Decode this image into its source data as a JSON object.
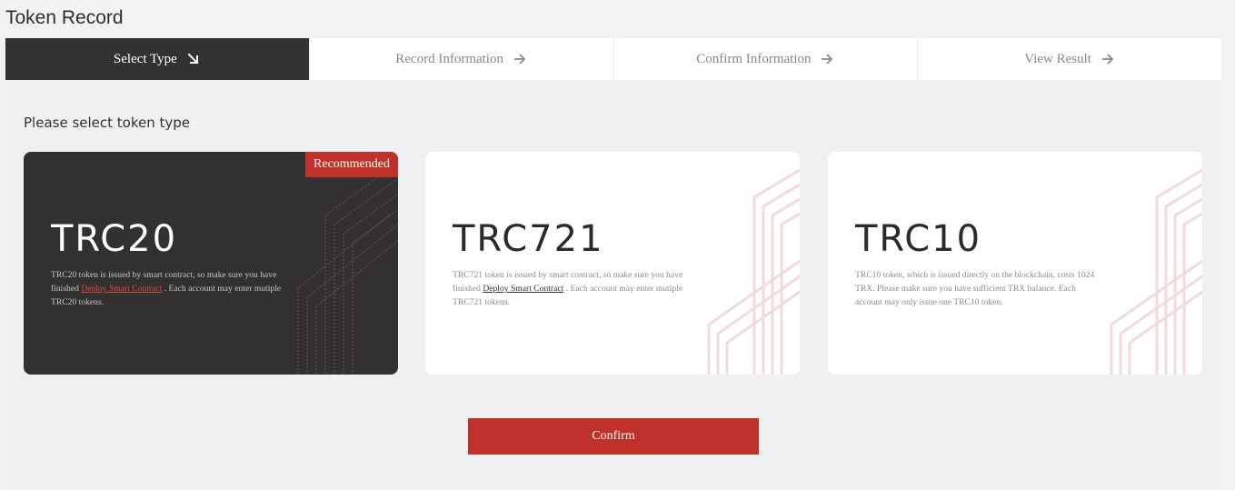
{
  "page": {
    "title": "Token Record"
  },
  "steps": [
    {
      "label": "Select Type",
      "active": true
    },
    {
      "label": "Record Information",
      "active": false
    },
    {
      "label": "Confirm Information",
      "active": false
    },
    {
      "label": "View Result",
      "active": false
    }
  ],
  "main": {
    "prompt": "Please select token type",
    "cards": [
      {
        "logo_text": "TRC20",
        "badge": "Recommended",
        "desc_before": "TRC20 token is issued by smart contract, so make sure you have finished ",
        "desc_link": "Deploy Smart Contract",
        "desc_after": " . Each account may enter mutiple TRC20 tokens.",
        "selected": true
      },
      {
        "logo_text": "TRC721",
        "desc_before": "TRC721 token is issued by smart contract, so make sure you have finished ",
        "desc_link": "Deploy Smart Contract",
        "desc_after": " . Each account may enter mutiple TRC721 tokens.",
        "selected": false
      },
      {
        "logo_text": "TRC10",
        "desc_before": "TRC10 token, which is issued directly on the blockchain, costs 1024 TRX. Please make sure you have sufficient TRX balance. Each account may only issue one TRC10 token.",
        "selected": false
      }
    ],
    "confirm_label": "Confirm"
  },
  "colors": {
    "accent": "#c1312b",
    "dark": "#333132",
    "background": "#f2f1f4"
  },
  "icons": {
    "active_step": "arrow-down-right-icon",
    "inactive_step": "arrow-right-icon"
  }
}
